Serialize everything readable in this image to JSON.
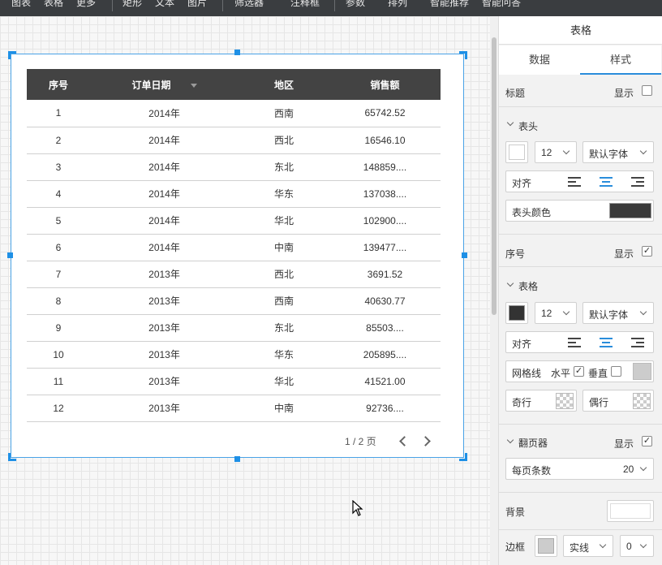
{
  "toolbar": {
    "items": [
      "图表",
      "表格",
      "更多",
      "矩形",
      "文本",
      "图片",
      "筛选器",
      "注释框",
      "参数",
      "排列",
      "智能推荐",
      "智能问答"
    ]
  },
  "table": {
    "columns": [
      "序号",
      "订单日期",
      "地区",
      "销售额"
    ],
    "rows": [
      [
        "1",
        "2014年",
        "西南",
        "65742.52"
      ],
      [
        "2",
        "2014年",
        "西北",
        "16546.10"
      ],
      [
        "3",
        "2014年",
        "东北",
        "148859...."
      ],
      [
        "4",
        "2014年",
        "华东",
        "137038...."
      ],
      [
        "5",
        "2014年",
        "华北",
        "102900...."
      ],
      [
        "6",
        "2014年",
        "中南",
        "139477...."
      ],
      [
        "7",
        "2013年",
        "西北",
        "3691.52"
      ],
      [
        "8",
        "2013年",
        "西南",
        "40630.77"
      ],
      [
        "9",
        "2013年",
        "东北",
        "85503...."
      ],
      [
        "10",
        "2013年",
        "华东",
        "205895...."
      ],
      [
        "11",
        "2013年",
        "华北",
        "41521.00"
      ],
      [
        "12",
        "2013年",
        "中南",
        "92736...."
      ]
    ],
    "pager": "1 / 2 页"
  },
  "panel": {
    "title": "表格",
    "tab_data": "数据",
    "tab_style": "样式",
    "title_row_label": "标题",
    "show": "显示",
    "header_section": "表头",
    "font_size": "12",
    "default_font": "默认字体",
    "align": "对齐",
    "header_color": "表头颜色",
    "serial_label": "序号",
    "table_section": "表格",
    "gridlines": "网格线",
    "horizontal": "水平",
    "vertical": "垂直",
    "odd_row": "奇行",
    "even_row": "偶行",
    "pager_section": "翻页器",
    "page_size_label": "每页条数",
    "page_size_value": "20",
    "background": "背景",
    "border": "边框",
    "border_style": "实线",
    "border_width": "0"
  },
  "colors": {
    "accent": "#2a8ddb",
    "header_bg": "#434343",
    "toolbar_bg": "#3a3d40"
  }
}
